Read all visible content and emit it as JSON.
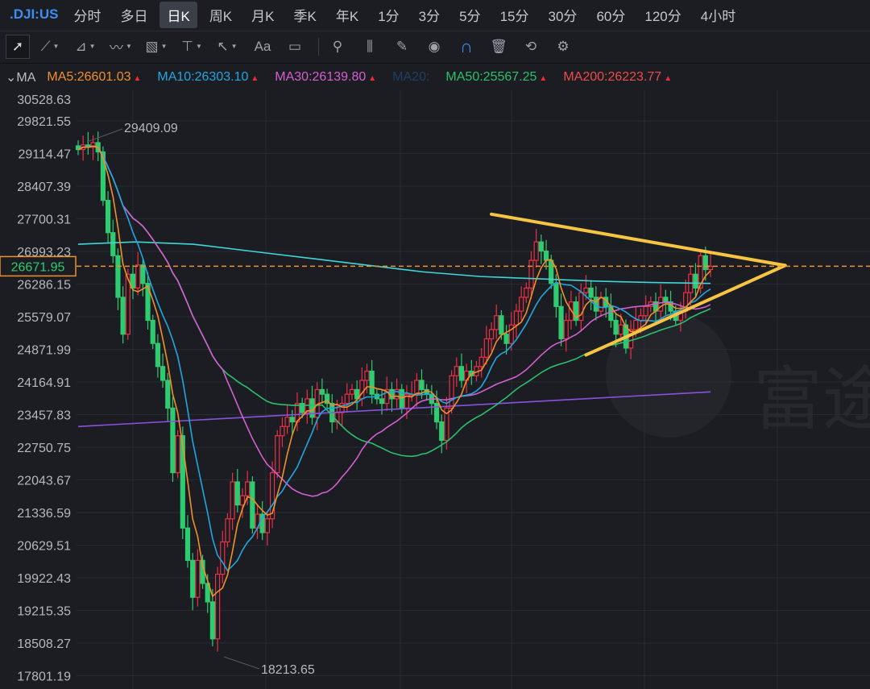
{
  "symbol": ".DJI:US",
  "tabs": [
    "分时",
    "多日",
    "日K",
    "周K",
    "月K",
    "季K",
    "年K",
    "1分",
    "3分",
    "5分",
    "15分",
    "30分",
    "60分",
    "120分",
    "4小时"
  ],
  "active_tab": "日K",
  "toolbar": {
    "font_label": "Aa",
    "icons": [
      "cursor-icon",
      "line-icon",
      "polyline-icon",
      "wave-icon",
      "fibonacci-icon",
      "level-icon",
      "arrow-icon",
      "text-icon",
      "comment-icon",
      "search-icon",
      "indicator-icon",
      "pencil-icon",
      "eye-icon",
      "magnet-icon",
      "trash-icon",
      "sync-icon",
      "gear-icon"
    ]
  },
  "ma": {
    "label": "MA",
    "items": [
      {
        "text": "MA5:26601.03",
        "color": "#f0902a",
        "up": true
      },
      {
        "text": "MA10:26303.10",
        "color": "#22a6e0",
        "up": true
      },
      {
        "text": "MA30:26139.80",
        "color": "#d45fd0",
        "up": true
      },
      {
        "text": "MA20:",
        "color": "#1f3f66",
        "up": false
      },
      {
        "text": "MA50:25567.25",
        "color": "#2cbf6d",
        "up": true
      },
      {
        "text": "MA200:26223.77",
        "color": "#ee4b4b",
        "up": true
      }
    ]
  },
  "chart_data": {
    "type": "candlestick",
    "y_ticks": [
      "30528.63",
      "29821.55",
      "29114.47",
      "28407.39",
      "27700.31",
      "26993.23",
      "26286.15",
      "25579.07",
      "24871.99",
      "24164.91",
      "23457.83",
      "22750.75",
      "22043.67",
      "21336.59",
      "20629.51",
      "19922.43",
      "19215.35",
      "18508.27",
      "17801.19"
    ],
    "ylim": [
      17801.19,
      30528.63
    ],
    "current_price": "26671.95",
    "high_label": "29409.09",
    "low_label": "18213.65",
    "closes": [
      29200,
      29300,
      29250,
      29350,
      29150,
      28100,
      27400,
      26900,
      26000,
      25200,
      26500,
      26200,
      26700,
      26300,
      25500,
      25000,
      24500,
      24200,
      23600,
      22200,
      23000,
      21000,
      20300,
      19500,
      20300,
      19800,
      19400,
      18600,
      20000,
      20700,
      21200,
      22000,
      21500,
      21700,
      22000,
      21000,
      21300,
      20900,
      21200,
      22200,
      23000,
      23200,
      23400,
      23300,
      23700,
      23500,
      23800,
      23400,
      24000,
      23900,
      23700,
      23300,
      23500,
      23700,
      23900,
      24000,
      23800,
      24200,
      24400,
      23900,
      23800,
      23700,
      24000,
      23800,
      24000,
      23600,
      23900,
      23900,
      24200,
      24000,
      23900,
      23700,
      23300,
      22900,
      23600,
      24300,
      24500,
      24200,
      24400,
      24300,
      24500,
      24700,
      25100,
      25300,
      25600,
      25200,
      25000,
      25400,
      25700,
      26000,
      26200,
      26800,
      27200,
      27000,
      26800,
      26300,
      25800,
      25100,
      25500,
      25900,
      25500,
      26100,
      26200,
      26000,
      25700,
      26000,
      25800,
      25500,
      25200,
      25400,
      24900,
      25300,
      25500,
      25600,
      25800,
      25900,
      25700,
      26000,
      25900,
      25700,
      25500,
      25700,
      26100,
      26500,
      26200,
      26900,
      26600,
      26672
    ],
    "ma_long": {
      "color": "#3fd6d9",
      "values": [
        27150,
        27200,
        27150,
        27000,
        26850,
        26700,
        26550,
        26450,
        26400,
        26350,
        26320,
        26300
      ]
    },
    "ma200": {
      "color": "#8a52e0",
      "values": [
        23200,
        23950
      ]
    },
    "trendlines": [
      {
        "from": [
          83,
          27800
        ],
        "to": [
          142,
          26690
        ]
      },
      {
        "from": [
          102,
          24750
        ],
        "to": [
          142,
          26690
        ]
      }
    ],
    "colors": {
      "up": "#ec3046",
      "down": "#2ecc71",
      "ma5": "#f0902a",
      "ma10": "#22a6e0",
      "ma30": "#d45fd0",
      "ma50": "#2cbf6d",
      "trend": "#f7c544",
      "price_line": "#f0902a"
    }
  },
  "watermark": "富途"
}
